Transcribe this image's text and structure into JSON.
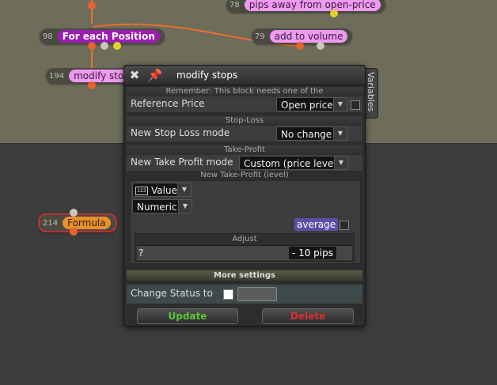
{
  "nodes": [
    {
      "id": "pips-away",
      "num": "78",
      "label": "pips away from open-price",
      "style": "pink"
    },
    {
      "id": "for-each",
      "num": "98",
      "label": "For each Position",
      "style": "purple"
    },
    {
      "id": "add-volume",
      "num": "79",
      "label": "add to volume",
      "style": "pink"
    },
    {
      "id": "modify-stops",
      "num": "194",
      "label": "modify stops",
      "style": "pink"
    },
    {
      "id": "formula",
      "num": "214",
      "label": "Formula",
      "style": "orange"
    }
  ],
  "dialog": {
    "title": "modify stops",
    "variables_tab": "Variables",
    "remember_note": "Remember: This block needs one of the",
    "reference_price_label": "Reference Price",
    "reference_price_value": "Open price",
    "stop_loss_header": "Stop-Loss",
    "sl_mode_label": "New Stop Loss mode",
    "sl_mode_value": "No change",
    "take_profit_header": "Take-Profit",
    "tp_mode_label": "New Take Profit mode",
    "tp_mode_value": "Custom (price level)",
    "tp_level_header": "New Take-Profit (level)",
    "value_type": "Value",
    "numeric_type": "Numeric",
    "average_label": "average",
    "adjust_header": "Adjust",
    "adjust_placeholder": "?",
    "adjust_value": "- 10 pips",
    "more_settings": "More settings",
    "change_status_label": "Change Status to",
    "update_button": "Update",
    "delete_button": "Delete"
  },
  "colors": {
    "canvas_top": "#6e6d5a",
    "canvas_bottom": "#3c3c3c",
    "link": "#e8702c",
    "update": "#5ac83a",
    "delete": "#d83030"
  }
}
